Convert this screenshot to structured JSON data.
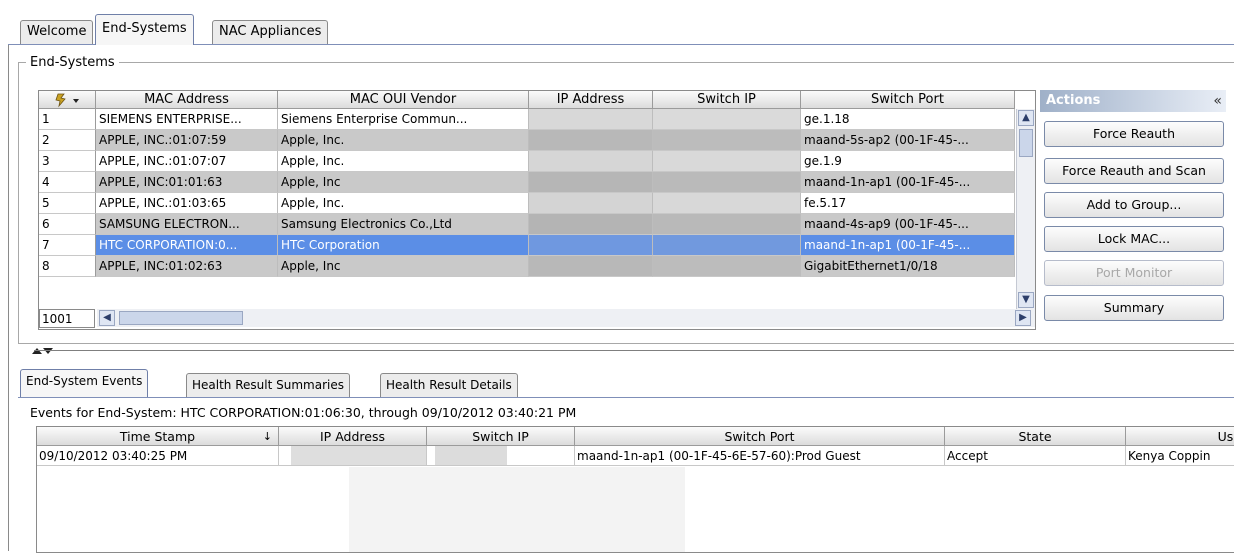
{
  "tabs": [
    "Welcome",
    "End-Systems",
    "NAC Appliances"
  ],
  "end_systems": {
    "group_title": "End-Systems",
    "columns": [
      "MAC Address",
      "MAC OUI Vendor",
      "IP Address",
      "Switch IP",
      "Switch Port"
    ],
    "rows": [
      {
        "num": "1",
        "mac": "SIEMENS ENTERPRISE...",
        "vendor": "Siemens Enterprise Commun...",
        "port": "ge.1.18"
      },
      {
        "num": "2",
        "mac": "APPLE, INC.:01:07:59",
        "vendor": "Apple, Inc.",
        "port": "maand-5s-ap2 (00-1F-45-..."
      },
      {
        "num": "3",
        "mac": "APPLE, INC.:01:07:07",
        "vendor": "Apple, Inc.",
        "port": "ge.1.9"
      },
      {
        "num": "4",
        "mac": "APPLE, INC:01:01:63",
        "vendor": "Apple, Inc",
        "port": "maand-1n-ap1 (00-1F-45-..."
      },
      {
        "num": "5",
        "mac": "APPLE, INC.:01:03:65",
        "vendor": "Apple, Inc.",
        "port": "fe.5.17"
      },
      {
        "num": "6",
        "mac": "SAMSUNG ELECTRON...",
        "vendor": "Samsung Electronics Co.,Ltd",
        "port": "maand-4s-ap9 (00-1F-45-..."
      },
      {
        "num": "7",
        "mac": "HTC CORPORATION:0...",
        "vendor": "HTC Corporation",
        "port": "maand-1n-ap1 (00-1F-45-..."
      },
      {
        "num": "8",
        "mac": "APPLE, INC:01:02:63",
        "vendor": "Apple, Inc",
        "port": "GigabitEthernet1/0/18"
      }
    ],
    "row_count": "1001"
  },
  "actions": {
    "title": "Actions",
    "collapse": "«",
    "buttons": [
      "Force Reauth",
      "Force Reauth and Scan",
      "Add to Group...",
      "Lock MAC...",
      "Port Monitor",
      "Summary"
    ]
  },
  "bottom": {
    "tabs": [
      "End-System Events",
      "Health Result Summaries",
      "Health Result Details"
    ],
    "events_label": "Events for End-System: HTC CORPORATION:01:06:30, through 09/10/2012 03:40:21 PM",
    "columns": [
      "Time Stamp",
      "IP Address",
      "Switch IP",
      "Switch Port",
      "State",
      "Use"
    ],
    "row": {
      "time": "09/10/2012 03:40:25 PM",
      "port": "maand-1n-ap1 (00-1F-45-6E-57-60):Prod Guest",
      "state": "Accept",
      "user": "Kenya Coppin"
    }
  }
}
